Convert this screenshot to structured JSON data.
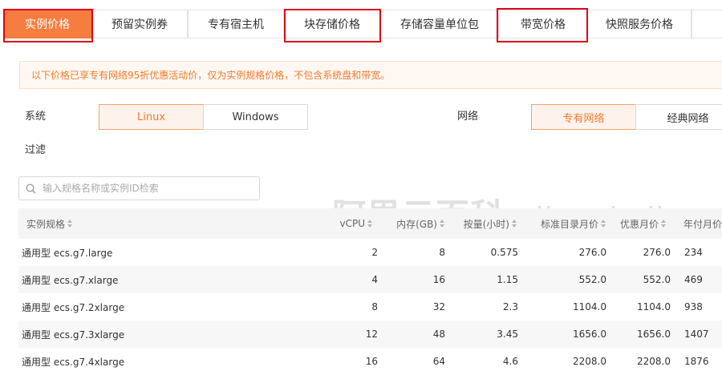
{
  "tabs": [
    {
      "label": "实例价格"
    },
    {
      "label": "预留实例券"
    },
    {
      "label": "专有宿主机"
    },
    {
      "label": "块存储价格"
    },
    {
      "label": "存储容量单位包"
    },
    {
      "label": "带宽价格"
    },
    {
      "label": "快照服务价格"
    }
  ],
  "notice": "以下价格已享专有网络95折优惠活动价，仅为实例规格价格，不包含系统盘和带宽。",
  "filters": {
    "os_label": "系统",
    "os_options": [
      "Linux",
      "Windows"
    ],
    "os_selected": "Linux",
    "network_label": "网络",
    "network_options": [
      "专有网络",
      "经典网络"
    ],
    "network_selected": "专有网络",
    "filter_label": "过滤"
  },
  "search": {
    "placeholder": "输入规格名称或实例ID检索"
  },
  "table": {
    "headers": [
      "实例规格",
      "vCPU",
      "内存(GB)",
      "按量(小时)",
      "标准目录月价",
      "优惠月价",
      "年付月价"
    ],
    "rows": [
      [
        "通用型 ecs.g7.large",
        "2",
        "8",
        "0.575",
        "276.0",
        "276.0",
        "234"
      ],
      [
        "通用型 ecs.g7.xlarge",
        "4",
        "16",
        "1.15",
        "552.0",
        "552.0",
        "469"
      ],
      [
        "通用型 ecs.g7.2xlarge",
        "8",
        "32",
        "2.3",
        "1104.0",
        "1104.0",
        "938"
      ],
      [
        "通用型 ecs.g7.3xlarge",
        "12",
        "48",
        "3.45",
        "1656.0",
        "1656.0",
        "1407"
      ],
      [
        "通用型 ecs.g7.4xlarge",
        "16",
        "64",
        "4.6",
        "2208.0",
        "2208.0",
        "1876"
      ]
    ]
  },
  "watermark": {
    "cn": "阿里云百科",
    "latin": "aliyunbaike.com"
  },
  "colors": {
    "accent": "#f57d3f",
    "highlight_box": "#e0001b",
    "notice_text": "#f27a2e"
  }
}
